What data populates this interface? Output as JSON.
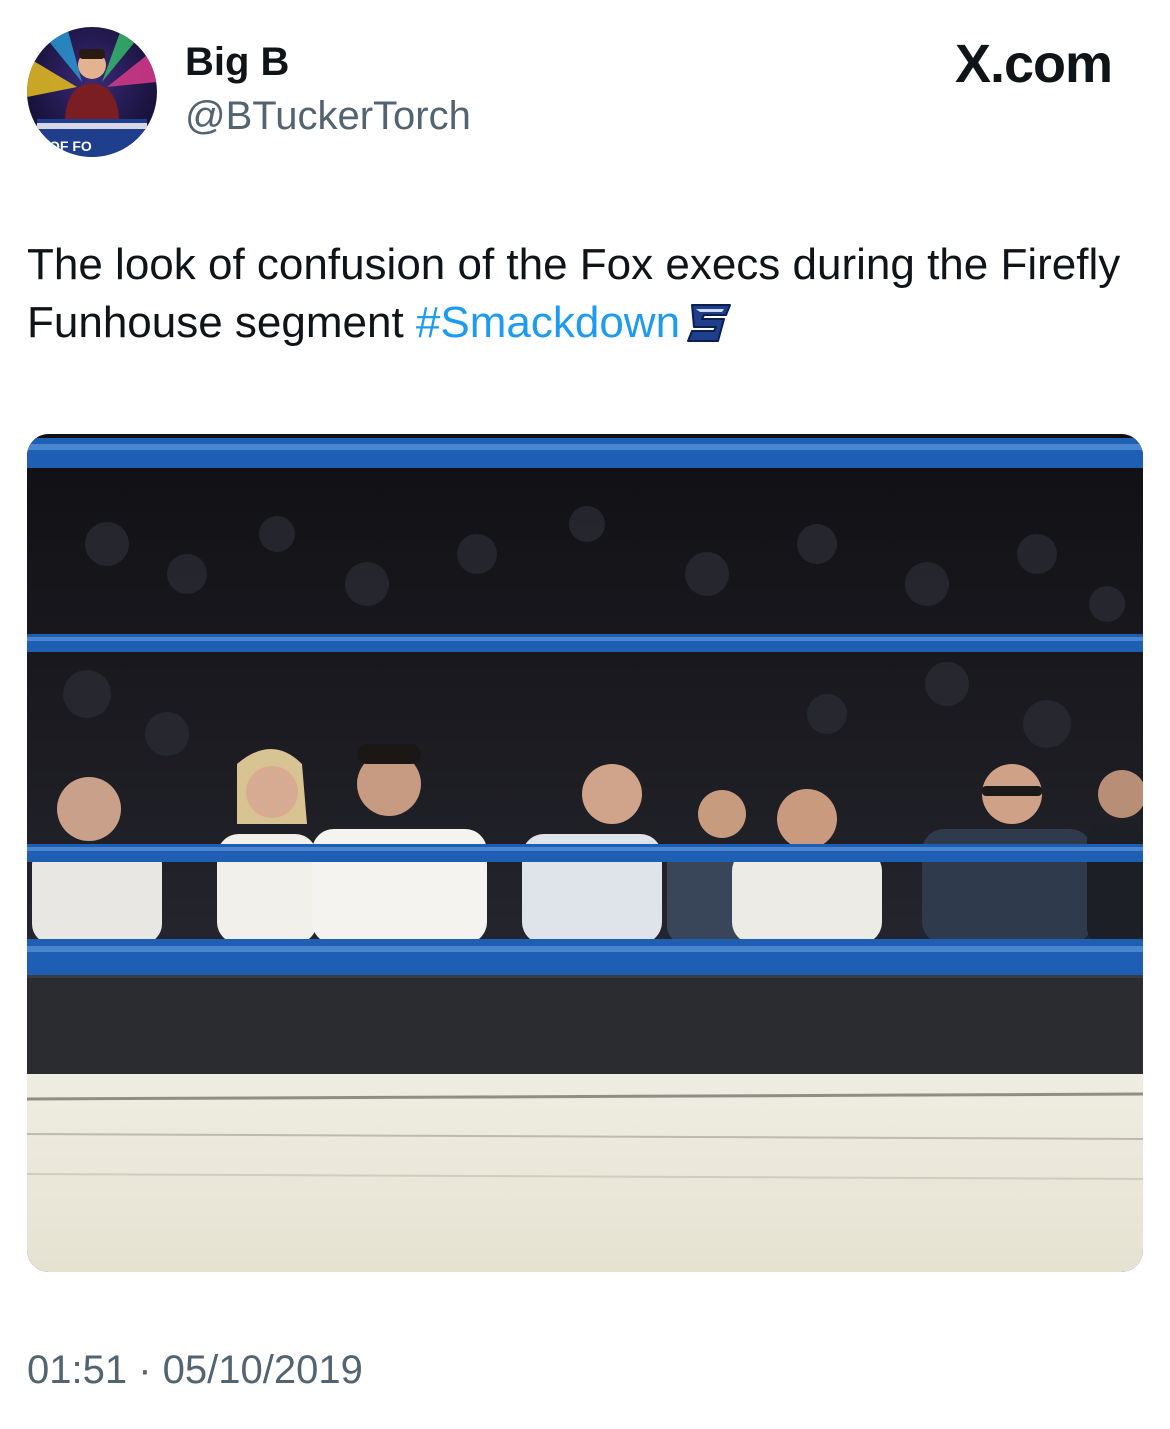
{
  "author": {
    "display_name": "Big B",
    "handle": "@BTuckerTorch"
  },
  "brand": "X.com",
  "tweet": {
    "text_prefix": "The look of confusion of the Fox execs during the Firefly Funhouse segment ",
    "hashtag": "#Smackdown",
    "hashflag_icon": "smackdown-s-logo-icon"
  },
  "timestamp": "01:51 · 05/10/2019",
  "colors": {
    "hashtag": "#1d9bf0",
    "text": "#0f1419",
    "secondary_text": "#536471",
    "ring_rope": "#1f5fb3"
  }
}
